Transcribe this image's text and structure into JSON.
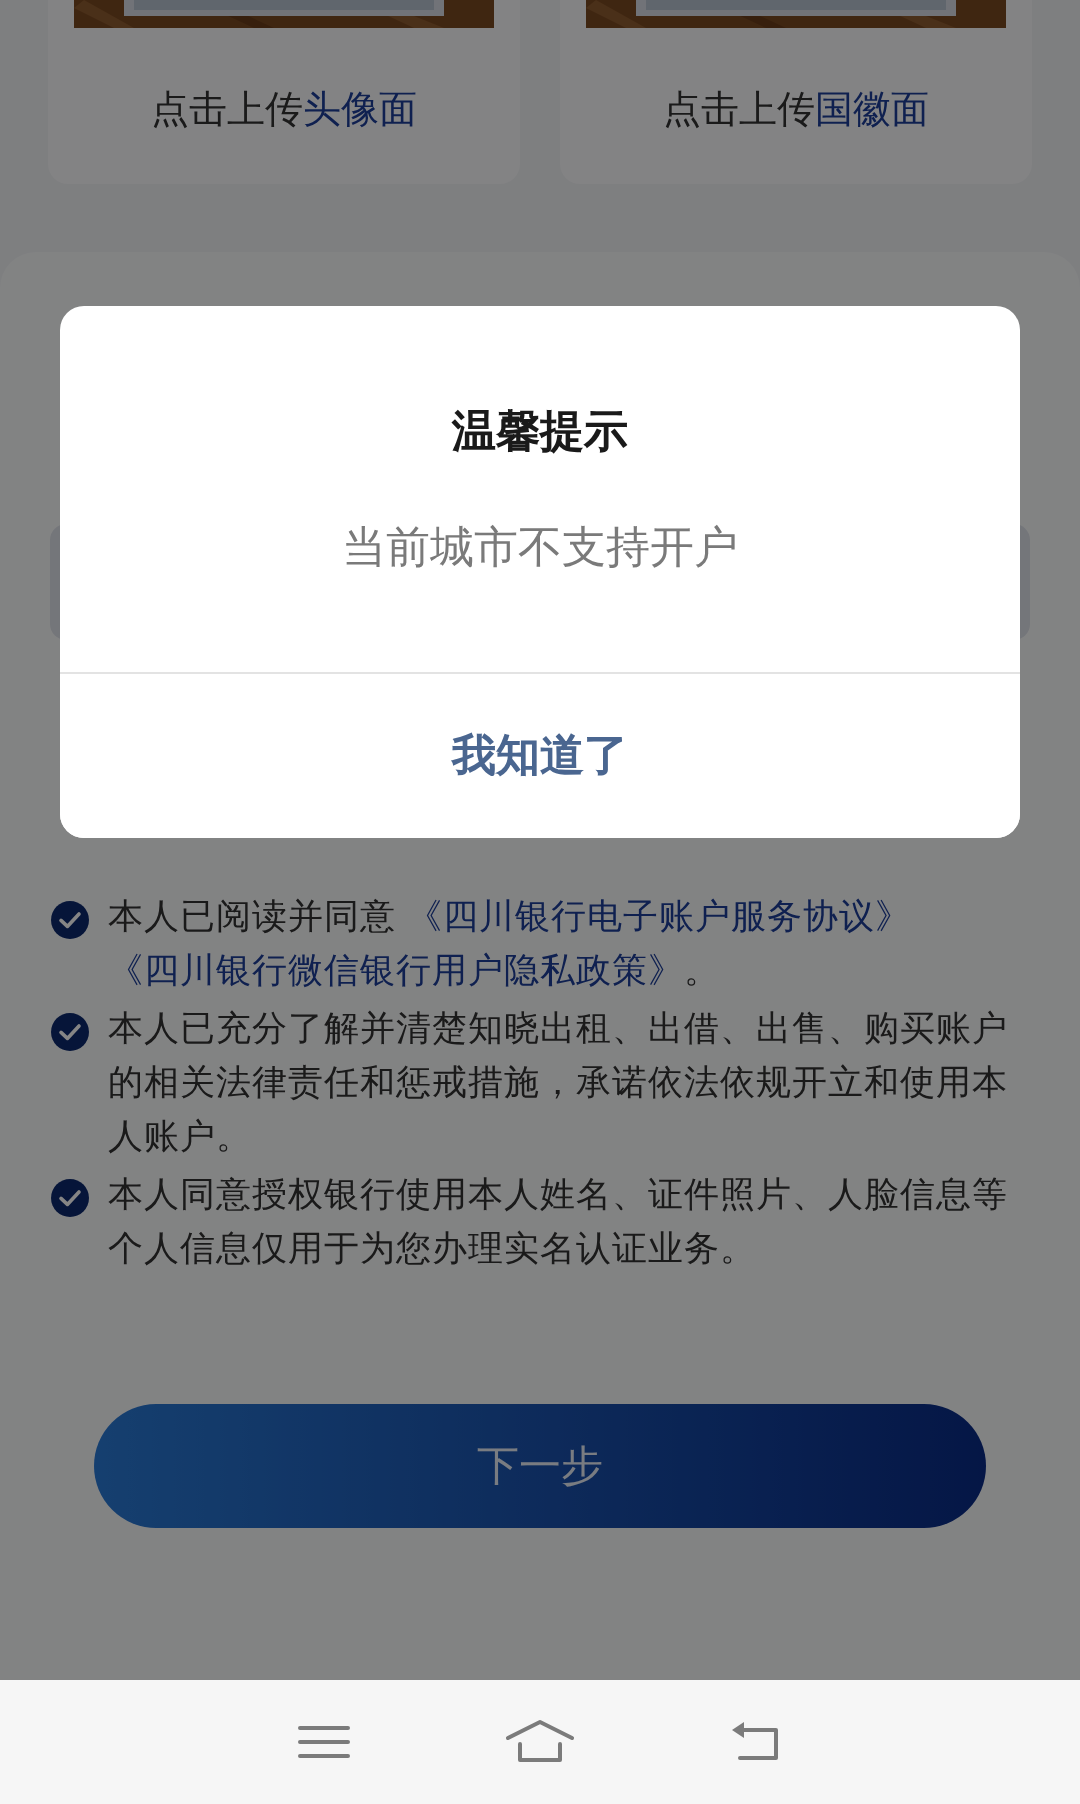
{
  "upload_cards": [
    {
      "kind": "picture",
      "prefix": "点击上传",
      "highlight": "头像面"
    },
    {
      "kind": "picture",
      "prefix": "点击上传",
      "highlight": "国徽面"
    }
  ],
  "agreements": [
    {
      "checked": true,
      "text": "本人已阅读并同意 ",
      "links": [
        "《四川银行电子账户服务协议》",
        "《四川银行微信银行用户隐私政策》"
      ],
      "suffix": "。"
    },
    {
      "checked": true,
      "text": "本人已充分了解并清楚知晓出租、出借、出售、购买账户的相关法律责任和惩戒措施，承诺依法依规开立和使用本人账户。"
    },
    {
      "checked": true,
      "text": "本人同意授权银行使用本人姓名、证件照片、人脸信息等个人信息仅用于为您办理实名认证业务。"
    }
  ],
  "next_button": "下一步",
  "dialog": {
    "title": "温馨提示",
    "message": "当前城市不支持开户",
    "button": "我知道了"
  },
  "nav_bar": [
    {
      "kind": "menu"
    },
    {
      "kind": "home"
    },
    {
      "kind": "back"
    }
  ]
}
